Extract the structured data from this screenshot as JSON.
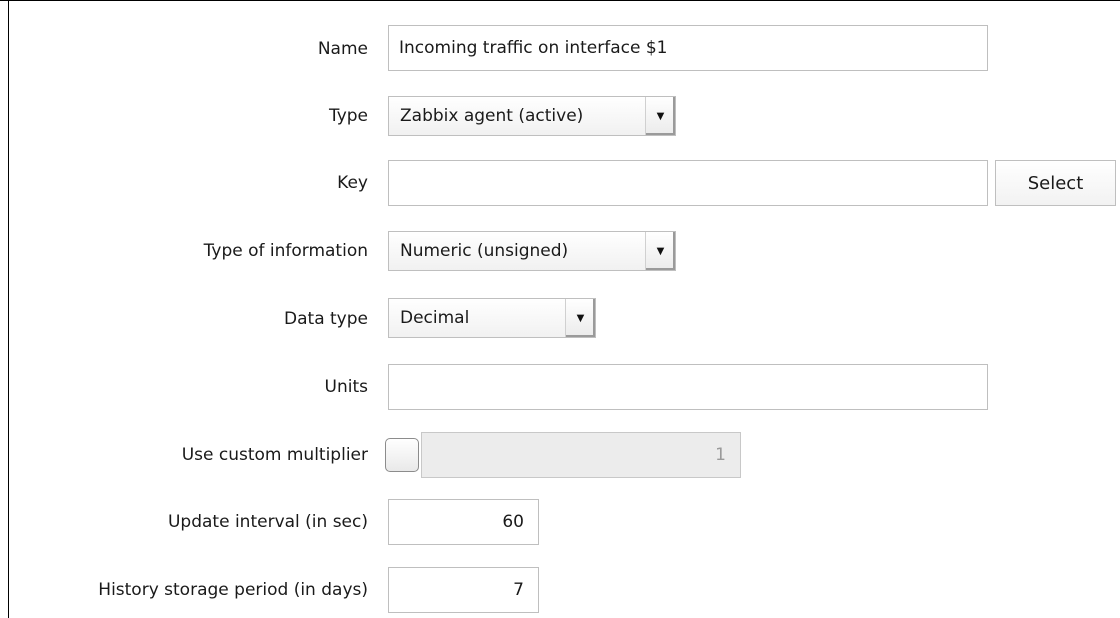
{
  "form": {
    "name": {
      "label": "Name",
      "value": "Incoming traffic on interface $1"
    },
    "type": {
      "label": "Type",
      "selected": "Zabbix agent (active)"
    },
    "key": {
      "label": "Key",
      "value": "",
      "button": "Select"
    },
    "type_of_information": {
      "label": "Type of information",
      "selected": "Numeric (unsigned)"
    },
    "data_type": {
      "label": "Data type",
      "selected": "Decimal"
    },
    "units": {
      "label": "Units",
      "value": ""
    },
    "custom_multiplier": {
      "label": "Use custom multiplier",
      "checked": false,
      "value": "1"
    },
    "update_interval": {
      "label": "Update interval (in sec)",
      "value": "60"
    },
    "history": {
      "label": "History storage period (in days)",
      "value": "7"
    }
  },
  "icons": {
    "dropdown": "chevron-down-icon"
  }
}
